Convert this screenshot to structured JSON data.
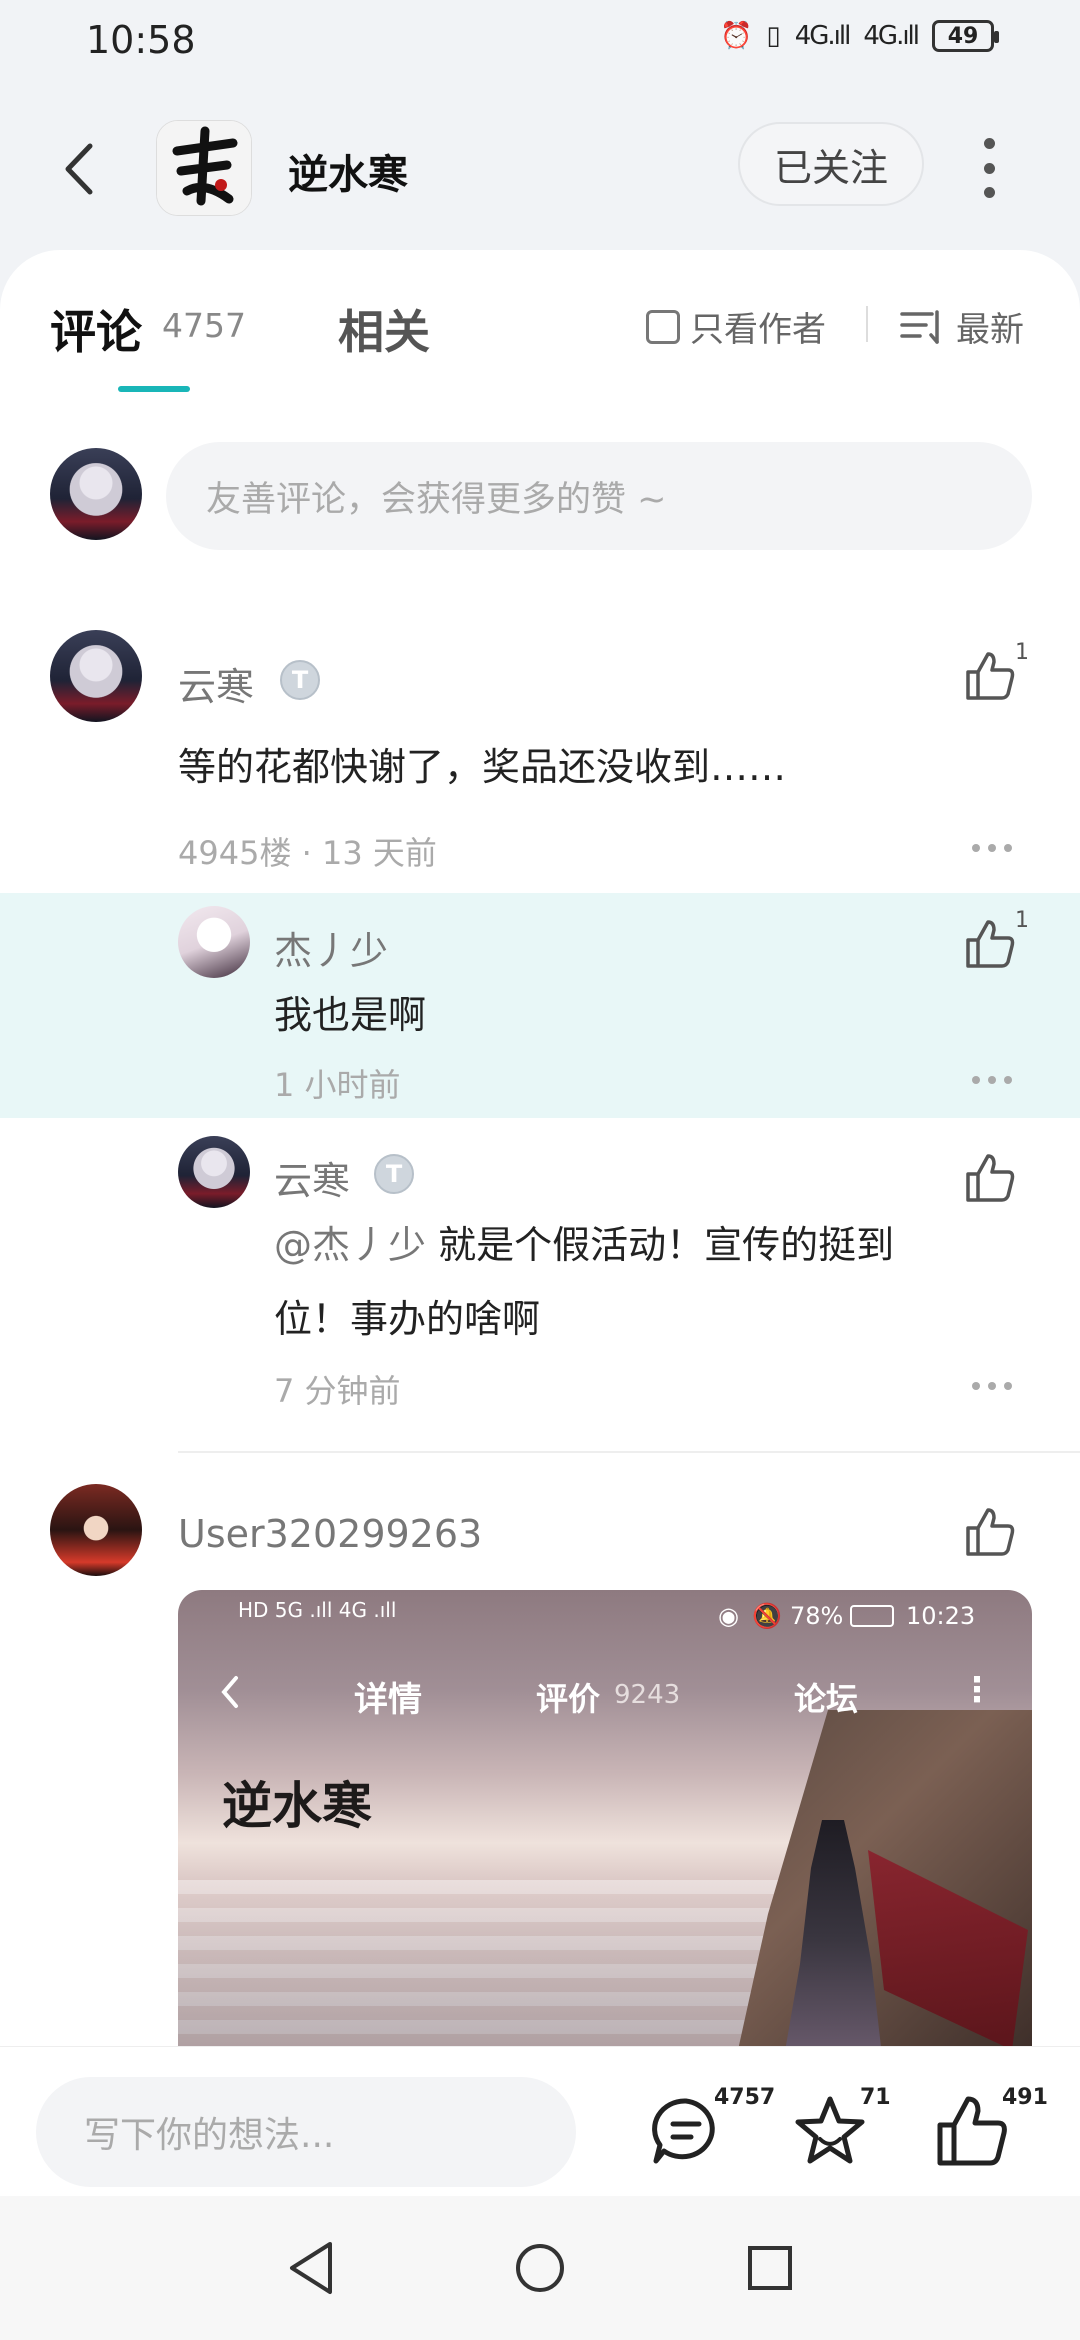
{
  "status_bar": {
    "time": "10:58",
    "signal_1": "4G",
    "signal_2": "4G",
    "battery": "49"
  },
  "header": {
    "game_title": "逆水寒",
    "follow_label": "已关注"
  },
  "tabs": {
    "comments_label": "评论",
    "comments_count": "4757",
    "related_label": "相关",
    "author_only_label": "只看作者",
    "sort_label": "最新"
  },
  "comment_input": {
    "placeholder": "友善评论，会获得更多的赞 ~"
  },
  "comments": [
    {
      "user": "云寒",
      "badge": "T",
      "text": "等的花都快谢了，奖品还没收到……",
      "meta": "4945楼 · 13 天前",
      "likes": "1",
      "replies": [
        {
          "user": "杰丿少",
          "text": "我也是啊",
          "meta": "1 小时前",
          "likes": "1"
        },
        {
          "user": "云寒",
          "badge": "T",
          "mention": "@杰丿少",
          "text_line1": "就是个假活动！宣传的挺到",
          "text_line2": "位！事办的啥啊",
          "meta": "7 分钟前"
        }
      ]
    },
    {
      "user": "User320299263",
      "screenshot": {
        "status_left": "HD 5G .ıll 4G .ıll",
        "status_right": "78%",
        "status_time": "10:23",
        "tab_details": "详情",
        "tab_reviews": "评价",
        "reviews_count": "9243",
        "tab_forum": "论坛",
        "logo_text": "逆水寒"
      }
    }
  ],
  "bottom_bar": {
    "write_placeholder": "写下你的想法...",
    "comment_count": "4757",
    "favorite_count": "71",
    "like_count": "491"
  },
  "colors": {
    "accent": "#19b6b8",
    "highlight_bg": "#e8f7f7"
  }
}
